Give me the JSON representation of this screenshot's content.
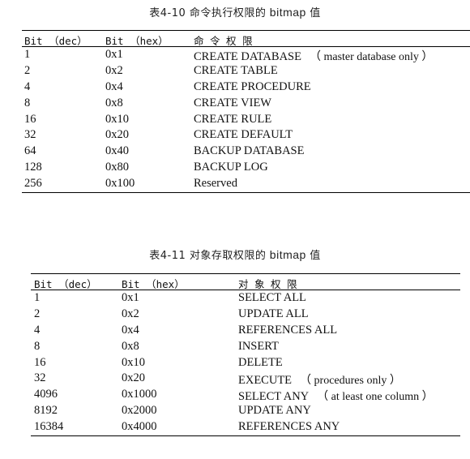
{
  "table1": {
    "caption_prefix": "表4-10 命令执行权限的",
    "caption_mid": " bitmap ",
    "caption_suffix": "值",
    "headers": {
      "dec": "Bit （dec）",
      "hex": "Bit （hex）",
      "name": "命 令 权 限"
    },
    "rows": [
      {
        "dec": "1",
        "hex": "0x1",
        "name": "CREATE DATABASE",
        "note": "（ master database only ）"
      },
      {
        "dec": "2",
        "hex": "0x2",
        "name": "CREATE TABLE",
        "note": ""
      },
      {
        "dec": "4",
        "hex": "0x4",
        "name": "CREATE PROCEDURE",
        "note": ""
      },
      {
        "dec": "8",
        "hex": "0x8",
        "name": "CREATE VIEW",
        "note": ""
      },
      {
        "dec": "16",
        "hex": "0x10",
        "name": "CREATE RULE",
        "note": ""
      },
      {
        "dec": "32",
        "hex": "0x20",
        "name": "CREATE DEFAULT",
        "note": ""
      },
      {
        "dec": "64",
        "hex": "0x40",
        "name": "BACKUP DATABASE",
        "note": ""
      },
      {
        "dec": "128",
        "hex": "0x80",
        "name": "BACKUP LOG",
        "note": ""
      },
      {
        "dec": "256",
        "hex": "0x100",
        "name": "Reserved",
        "note": ""
      }
    ]
  },
  "table2": {
    "caption_prefix": "表4-11 对象存取权限的",
    "caption_mid": " bitmap ",
    "caption_suffix": "值",
    "headers": {
      "dec": "Bit （dec）",
      "hex": "Bit （hex）",
      "name": "对 象 权 限"
    },
    "rows": [
      {
        "dec": "1",
        "hex": "0x1",
        "name": "SELECT ALL",
        "note": ""
      },
      {
        "dec": "2",
        "hex": "0x2",
        "name": "UPDATE ALL",
        "note": ""
      },
      {
        "dec": "4",
        "hex": "0x4",
        "name": "REFERENCES ALL",
        "note": ""
      },
      {
        "dec": "8",
        "hex": "0x8",
        "name": "INSERT",
        "note": ""
      },
      {
        "dec": "16",
        "hex": "0x10",
        "name": "DELETE",
        "note": ""
      },
      {
        "dec": "32",
        "hex": "0x20",
        "name": "EXECUTE",
        "note": "（ procedures only ）"
      },
      {
        "dec": "4096",
        "hex": "0x1000",
        "name": "SELECT ANY",
        "note": "（ at least one column ）"
      },
      {
        "dec": "8192",
        "hex": "0x2000",
        "name": "UPDATE ANY",
        "note": ""
      },
      {
        "dec": "16384",
        "hex": "0x4000",
        "name": "REFERENCES ANY",
        "note": ""
      }
    ]
  }
}
